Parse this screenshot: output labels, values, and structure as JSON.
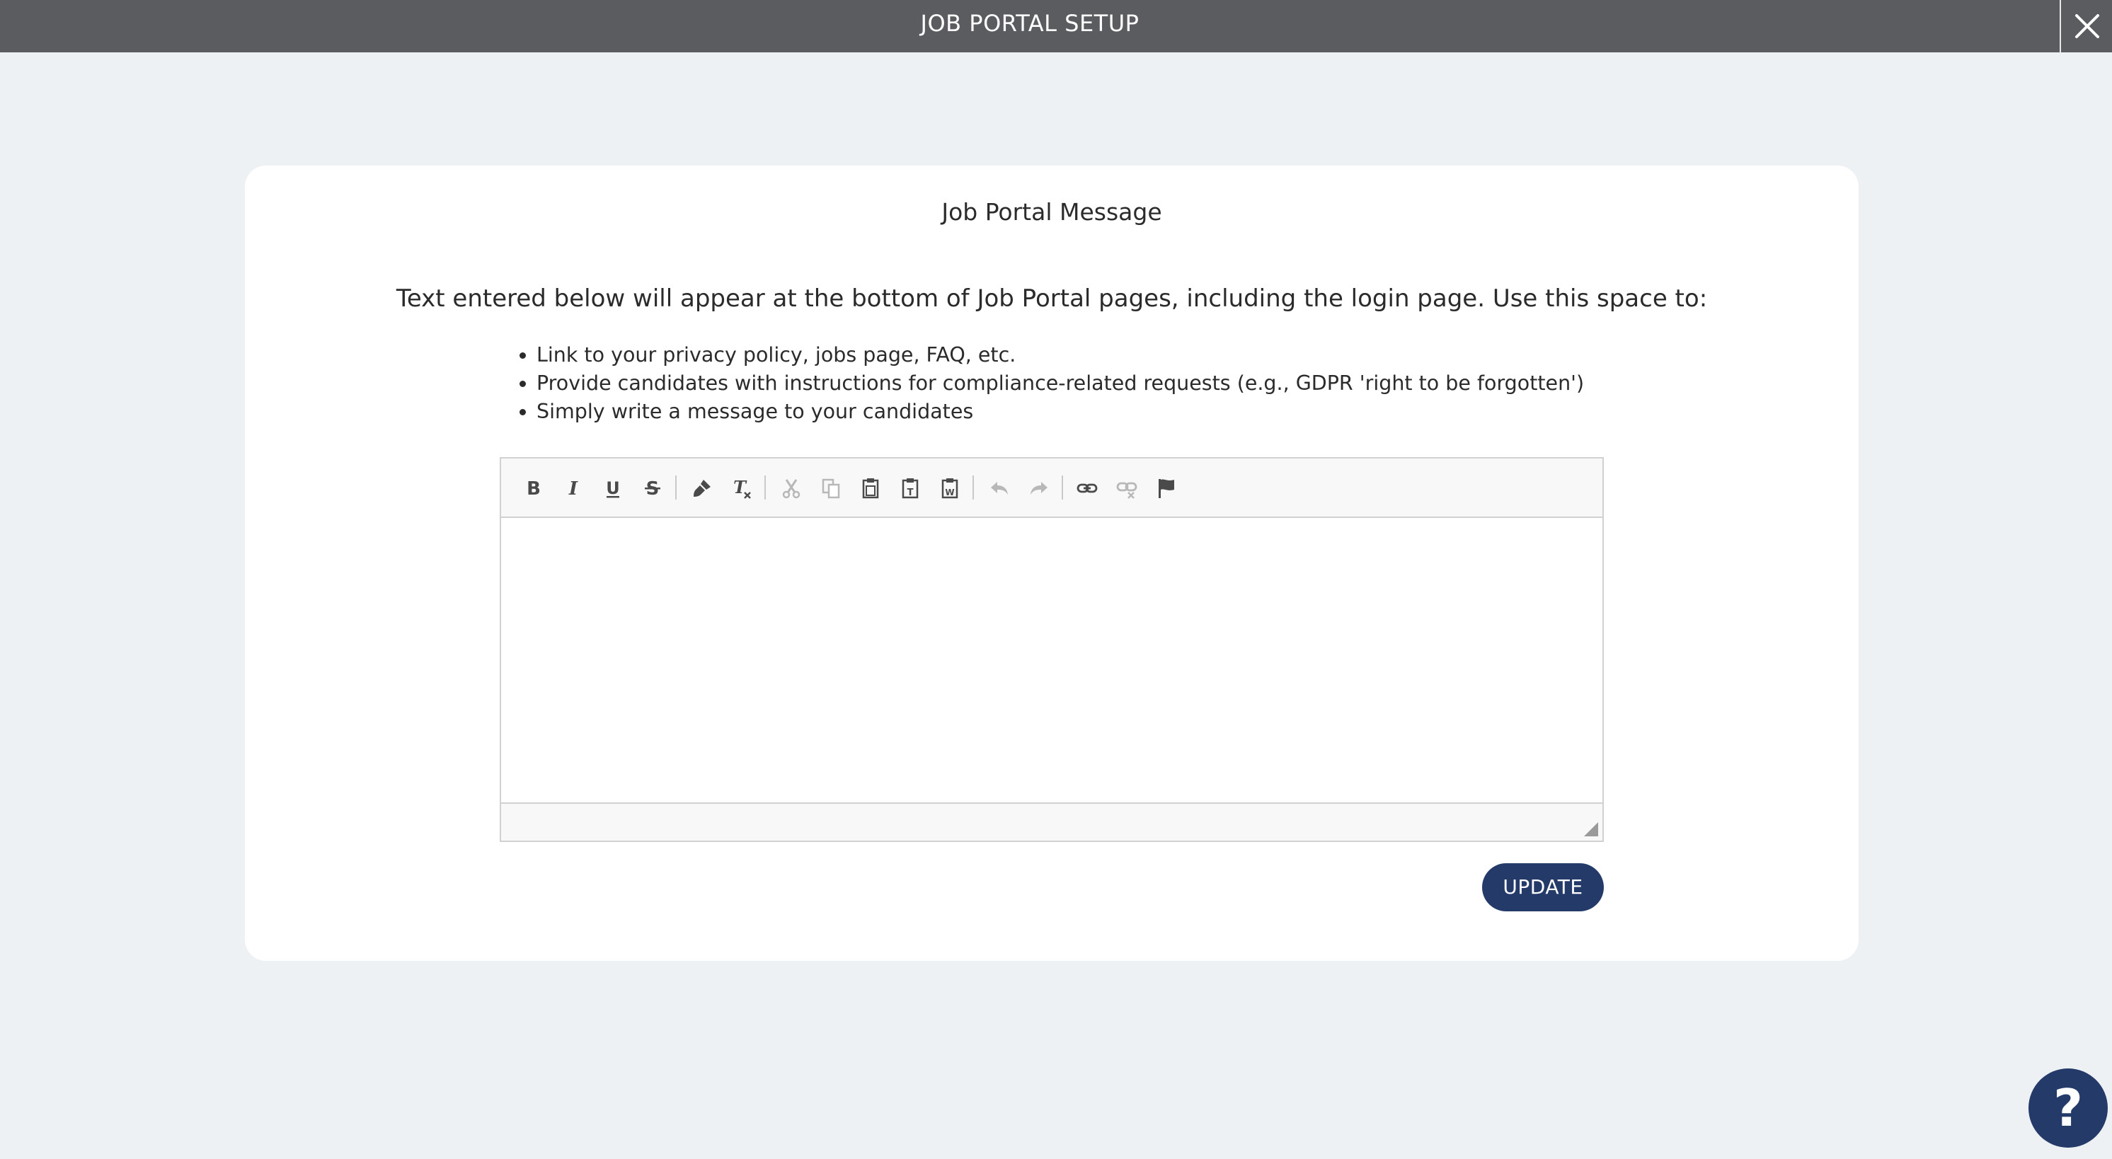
{
  "header": {
    "title": "JOB PORTAL SETUP",
    "close_icon": "close-icon"
  },
  "card": {
    "title": "Job Portal Message",
    "intro": "Text entered below will appear at the bottom of Job Portal pages, including the login page. Use this space to:",
    "bullets": [
      "Link to your privacy policy, jobs page, FAQ, etc.",
      "Provide candidates with instructions for compliance-related requests (e.g., GDPR 'right to be forgotten')",
      "Simply write a message to your candidates"
    ]
  },
  "editor": {
    "content": "",
    "toolbar": [
      {
        "icon": "bold-icon",
        "enabled": true
      },
      {
        "icon": "italic-icon",
        "enabled": true
      },
      {
        "icon": "underline-icon",
        "enabled": true
      },
      {
        "icon": "strikethrough-icon",
        "enabled": true
      },
      {
        "icon": "copy-format-icon",
        "enabled": true
      },
      {
        "icon": "remove-format-icon",
        "enabled": true
      },
      {
        "icon": "cut-icon",
        "enabled": false
      },
      {
        "icon": "copy-icon",
        "enabled": false
      },
      {
        "icon": "paste-icon",
        "enabled": true
      },
      {
        "icon": "paste-text-icon",
        "enabled": true
      },
      {
        "icon": "paste-from-word-icon",
        "enabled": true
      },
      {
        "icon": "undo-icon",
        "enabled": false
      },
      {
        "icon": "redo-icon",
        "enabled": false
      },
      {
        "icon": "link-icon",
        "enabled": true
      },
      {
        "icon": "unlink-icon",
        "enabled": false
      },
      {
        "icon": "anchor-icon",
        "enabled": true
      }
    ]
  },
  "actions": {
    "update_label": "UPDATE"
  },
  "help": {
    "label": "?"
  },
  "colors": {
    "topbar": "#5a5c60",
    "background": "#eef1f4",
    "primary_button": "#243b6a",
    "icon_enabled": "#4a4a4a",
    "icon_disabled": "#b8b8b8"
  }
}
